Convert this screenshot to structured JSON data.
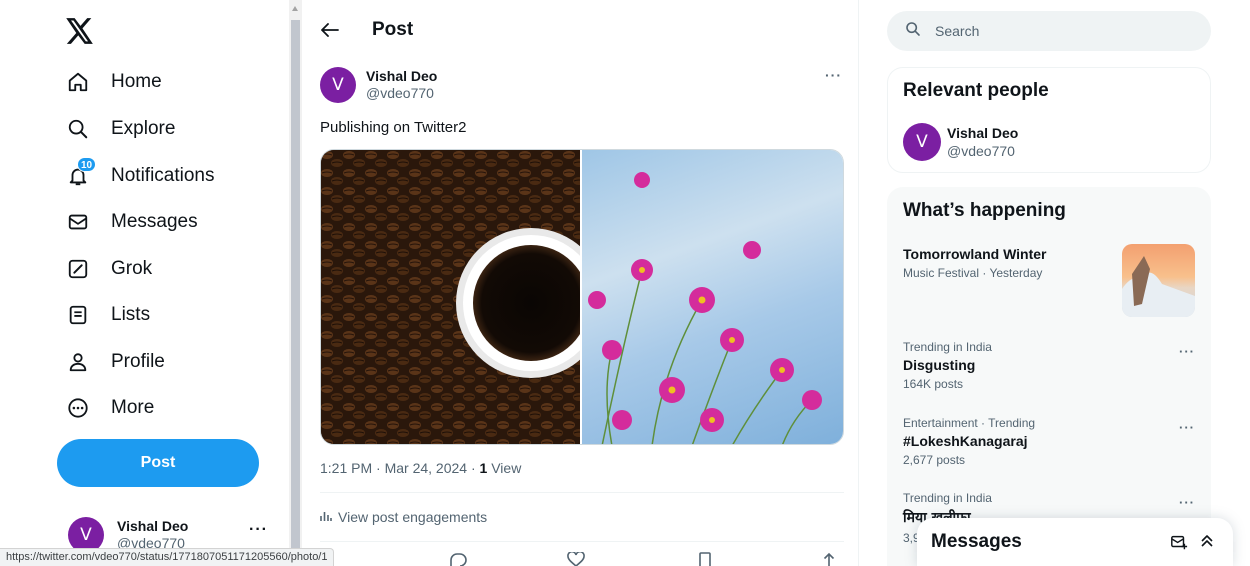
{
  "nav": {
    "items": [
      {
        "label": "Home",
        "icon": "home-icon"
      },
      {
        "label": "Explore",
        "icon": "search-icon"
      },
      {
        "label": "Notifications",
        "icon": "bell-icon",
        "badge": "10"
      },
      {
        "label": "Messages",
        "icon": "envelope-icon"
      },
      {
        "label": "Grok",
        "icon": "grok-icon"
      },
      {
        "label": "Lists",
        "icon": "list-icon"
      },
      {
        "label": "Profile",
        "icon": "person-icon"
      },
      {
        "label": "More",
        "icon": "more-circle-icon"
      }
    ],
    "post_button": "Post",
    "account": {
      "initial": "V",
      "name": "Vishal Deo",
      "handle": "@vdeo770",
      "more": "···"
    }
  },
  "main": {
    "header_title": "Post",
    "post": {
      "author_initial": "V",
      "author_name": "Vishal Deo",
      "author_handle": "@vdeo770",
      "more": "···",
      "text": "Publishing on Twitter2",
      "meta_time": "1:21 PM · Mar 24, 2024 · ",
      "views_count": "1",
      "views_label": " View",
      "engagements": "View post engagements"
    }
  },
  "sidebar": {
    "search_placeholder": "Search",
    "relevant": {
      "title": "Relevant people",
      "initial": "V",
      "name": "Vishal Deo",
      "handle": "@vdeo770"
    },
    "happening": {
      "title": "What’s happening",
      "featured": {
        "topic": "Tomorrowland Winter",
        "ctx": "Music Festival · Yesterday"
      },
      "trends": [
        {
          "ctx": "Trending in India",
          "topic": "Disgusting",
          "count": "164K posts"
        },
        {
          "ctx": "Entertainment · Trending",
          "topic": "#LokeshKanagaraj",
          "count": "2,677 posts"
        },
        {
          "ctx": "Trending in India",
          "topic": "मिया खलीफा",
          "count": "3,9"
        }
      ],
      "more": "···"
    }
  },
  "drawer": {
    "title": "Messages"
  },
  "status_url": "https://twitter.com/vdeo770/status/1771807051171205560/photo/1",
  "colors": {
    "accent": "#1d9bf0",
    "avatar": "#7b1fa2",
    "text": "#0f1419",
    "muted": "#536471"
  }
}
